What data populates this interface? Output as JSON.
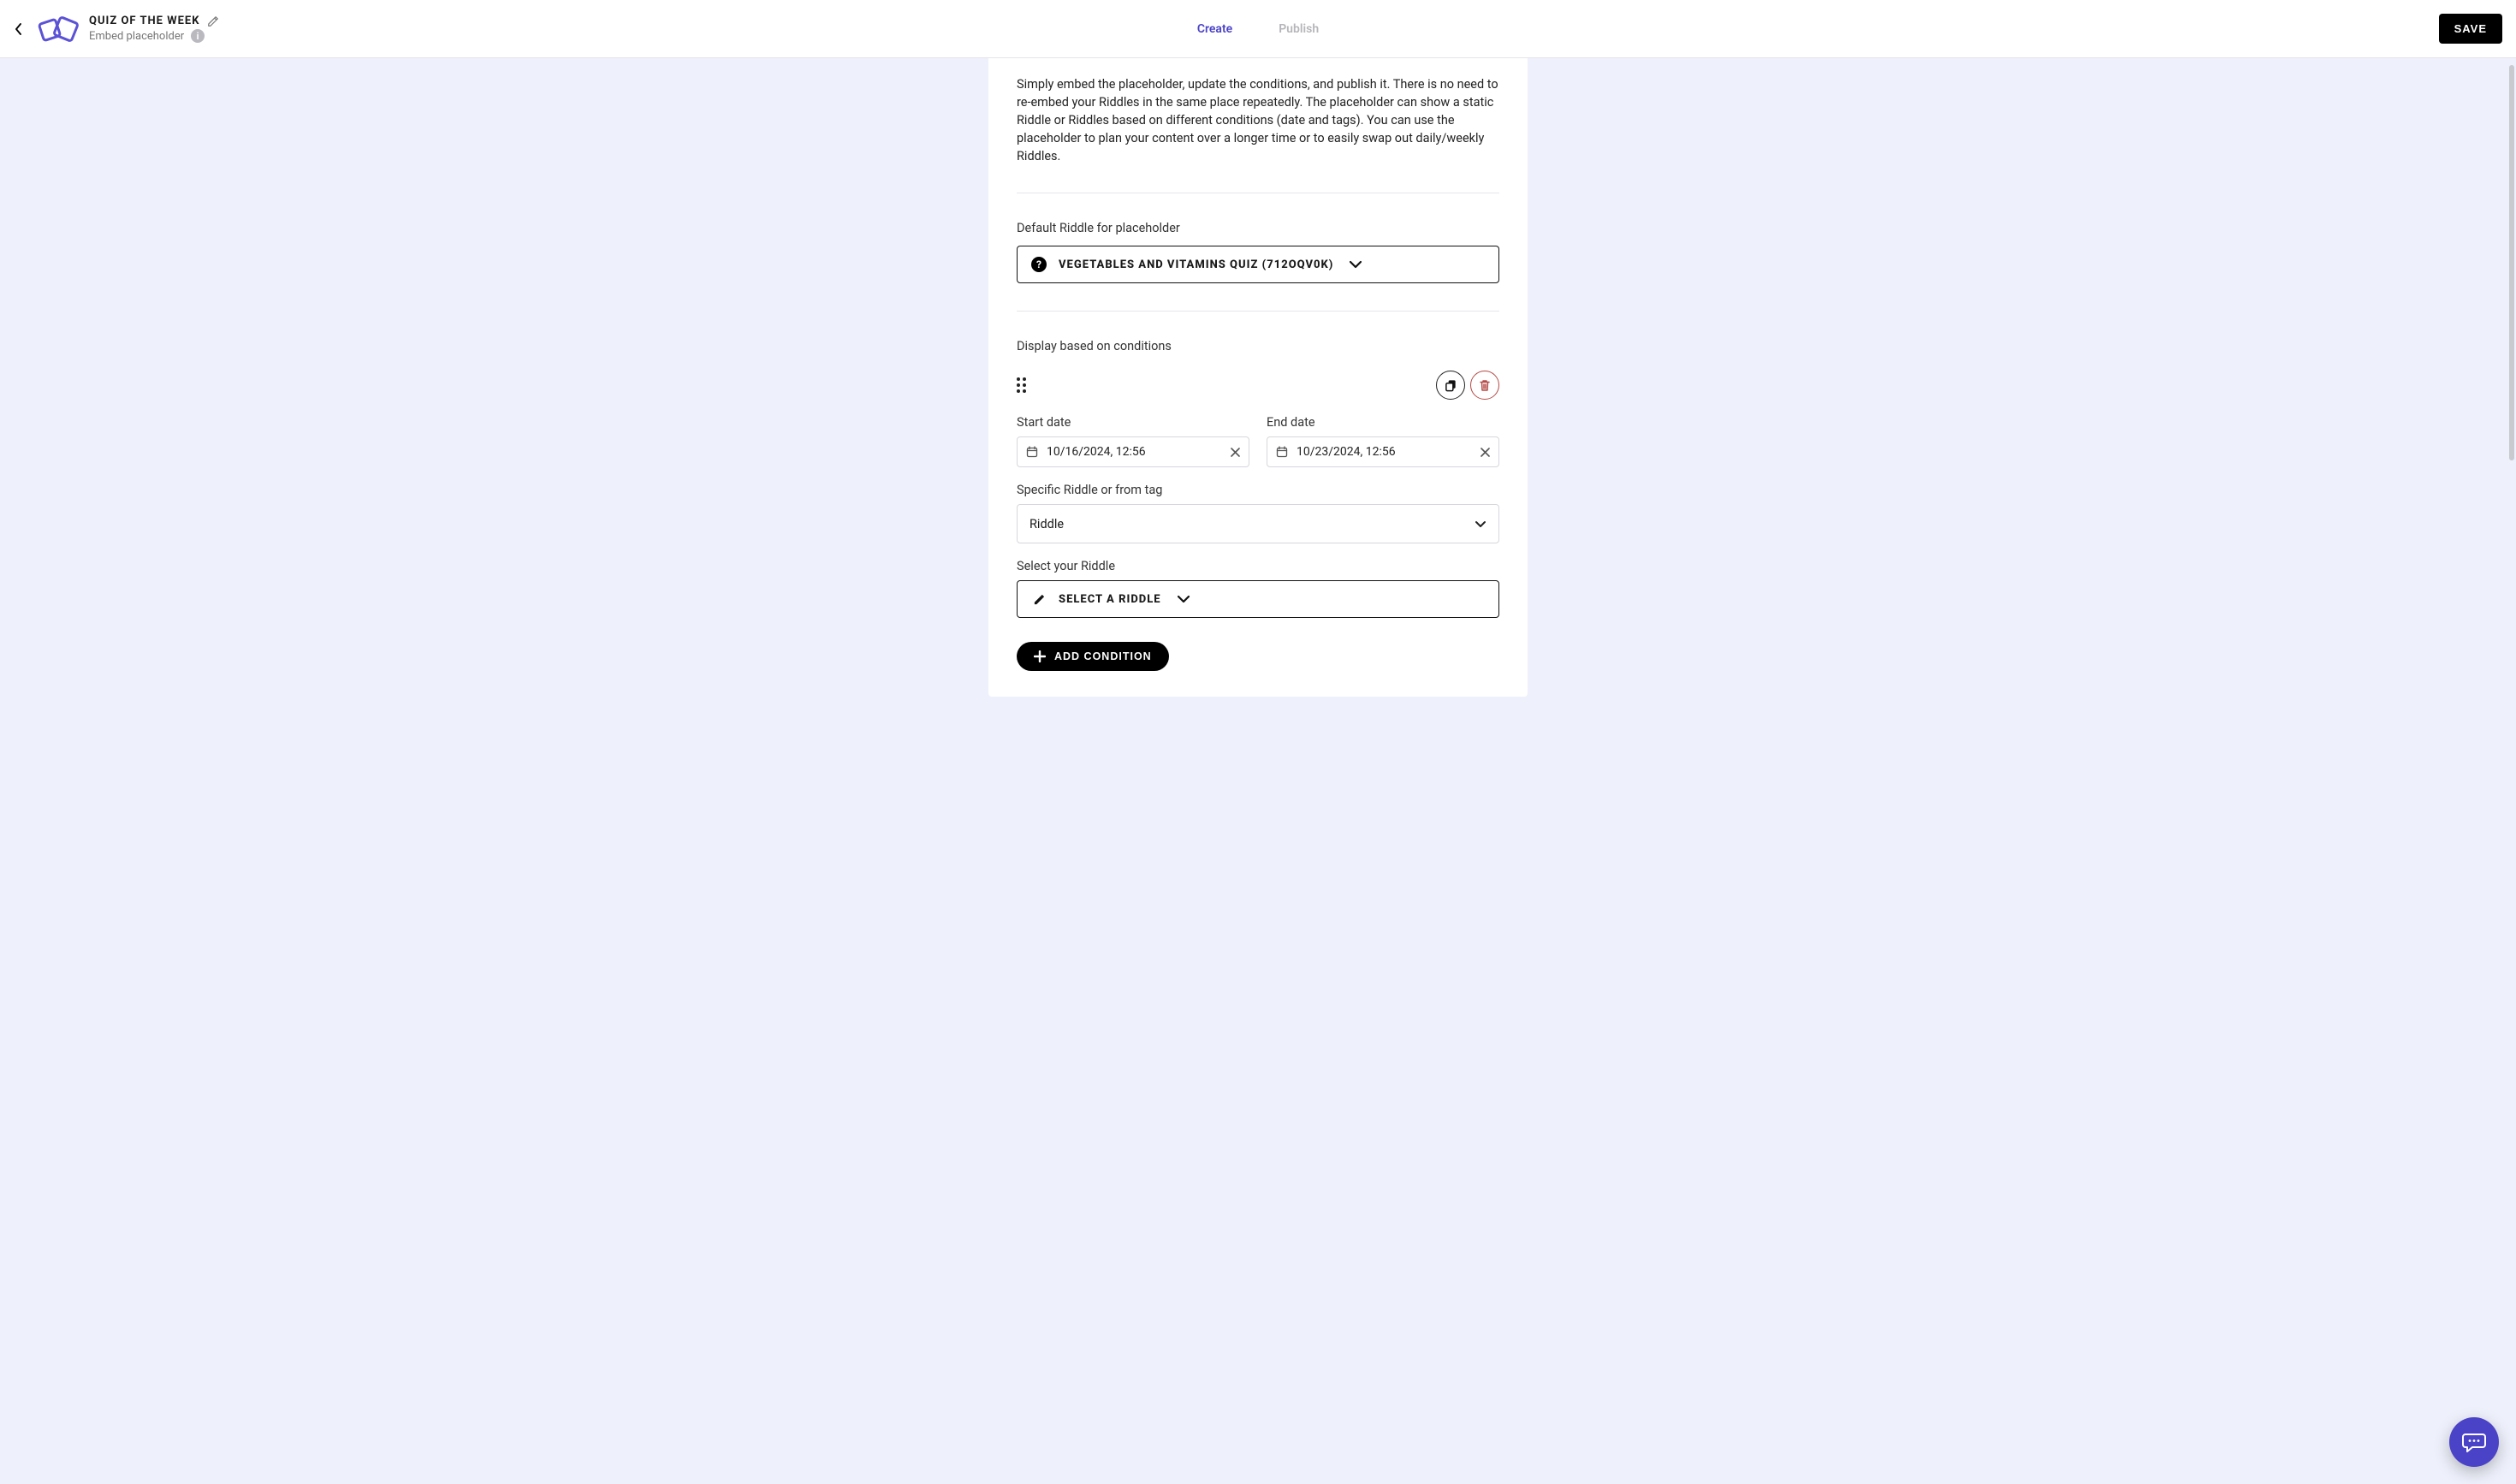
{
  "header": {
    "title": "QUIZ OF THE WEEK",
    "subtitle": "Embed placeholder",
    "tabs": {
      "create": "Create",
      "publish": "Publish"
    },
    "save": "SAVE"
  },
  "intro": "Simply embed the placeholder, update the conditions, and publish it. There is no need to re-embed your Riddles in the same place repeatedly. The placeholder can show a static Riddle or Riddles based on different conditions (date and tags). You can use the placeholder to plan your content over a longer time or to easily swap out daily/weekly Riddles.",
  "defaultRiddle": {
    "label": "Default Riddle for placeholder",
    "value": "VEGETABLES AND VITAMINS QUIZ (712OQV0K)"
  },
  "conditions": {
    "label": "Display based on conditions",
    "startDate": {
      "label": "Start date",
      "value": "10/16/2024, 12:56"
    },
    "endDate": {
      "label": "End date",
      "value": "10/23/2024, 12:56"
    },
    "source": {
      "label": "Specific Riddle or from tag",
      "value": "Riddle"
    },
    "select": {
      "label": "Select your Riddle",
      "value": "SELECT A RIDDLE"
    },
    "addButton": "ADD CONDITION"
  }
}
